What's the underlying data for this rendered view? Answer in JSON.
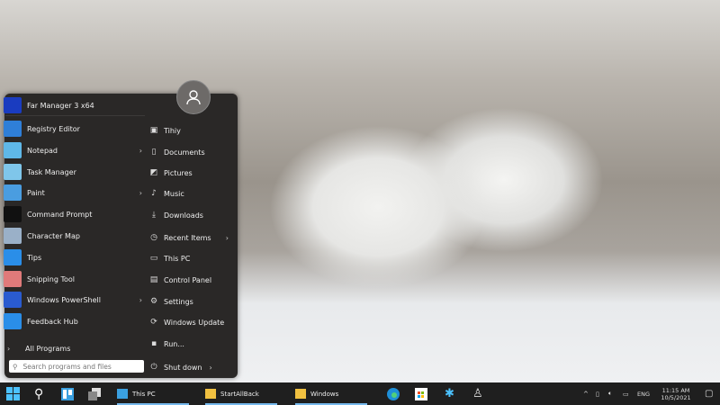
{
  "start_menu": {
    "user_avatar": "user-icon",
    "pinned_top": "Far Manager 3 x64",
    "programs": [
      {
        "label": "Registry Editor",
        "color": "#2f7fd8",
        "submenu": false
      },
      {
        "label": "Notepad",
        "color": "#5fb8e8",
        "submenu": true
      },
      {
        "label": "Task Manager",
        "color": "#7fc6ea",
        "submenu": false
      },
      {
        "label": "Paint",
        "color": "#4a9de0",
        "submenu": true
      },
      {
        "label": "Command Prompt",
        "color": "#111111",
        "submenu": false
      },
      {
        "label": "Character Map",
        "color": "#9ab0c8",
        "submenu": false
      },
      {
        "label": "Tips",
        "color": "#2a8ee8",
        "submenu": false
      },
      {
        "label": "Snipping Tool",
        "color": "#e07a7a",
        "submenu": false
      },
      {
        "label": "Windows PowerShell",
        "color": "#2a5bd0",
        "submenu": true
      },
      {
        "label": "Feedback Hub",
        "color": "#2a8ee8",
        "submenu": false
      }
    ],
    "all_programs": "All Programs",
    "search_placeholder": "Search programs and files",
    "places": [
      {
        "label": "Tihiy",
        "icon": "user-folder-icon",
        "glyph": "▣",
        "submenu": false
      },
      {
        "label": "Documents",
        "icon": "document-icon",
        "glyph": "▯",
        "submenu": false
      },
      {
        "label": "Pictures",
        "icon": "pictures-icon",
        "glyph": "◩",
        "submenu": false
      },
      {
        "label": "Music",
        "icon": "music-icon",
        "glyph": "♪",
        "submenu": false
      },
      {
        "label": "Downloads",
        "icon": "download-icon",
        "glyph": "⤓",
        "submenu": false
      },
      {
        "label": "Recent Items",
        "icon": "clock-icon",
        "glyph": "◷",
        "submenu": true
      },
      {
        "label": "This PC",
        "icon": "computer-icon",
        "glyph": "▭",
        "submenu": false
      },
      {
        "label": "Control Panel",
        "icon": "control-panel-icon",
        "glyph": "▤",
        "submenu": false
      },
      {
        "label": "Settings",
        "icon": "gear-icon",
        "glyph": "⚙",
        "submenu": false
      },
      {
        "label": "Windows Update",
        "icon": "refresh-icon",
        "glyph": "⟳",
        "submenu": false
      },
      {
        "label": "Run...",
        "icon": "run-icon",
        "glyph": "▪",
        "submenu": false
      }
    ],
    "shutdown": "Shut down"
  },
  "taskbar": {
    "windows": [
      {
        "label": "This PC",
        "color": "#3aa0e0"
      },
      {
        "label": "StartAllBack",
        "color": "#f0c040"
      },
      {
        "label": "Windows",
        "color": "#f0c040"
      }
    ],
    "tray": {
      "language": "ENG",
      "time": "11:15 AM",
      "date": "10/5/2021"
    }
  }
}
